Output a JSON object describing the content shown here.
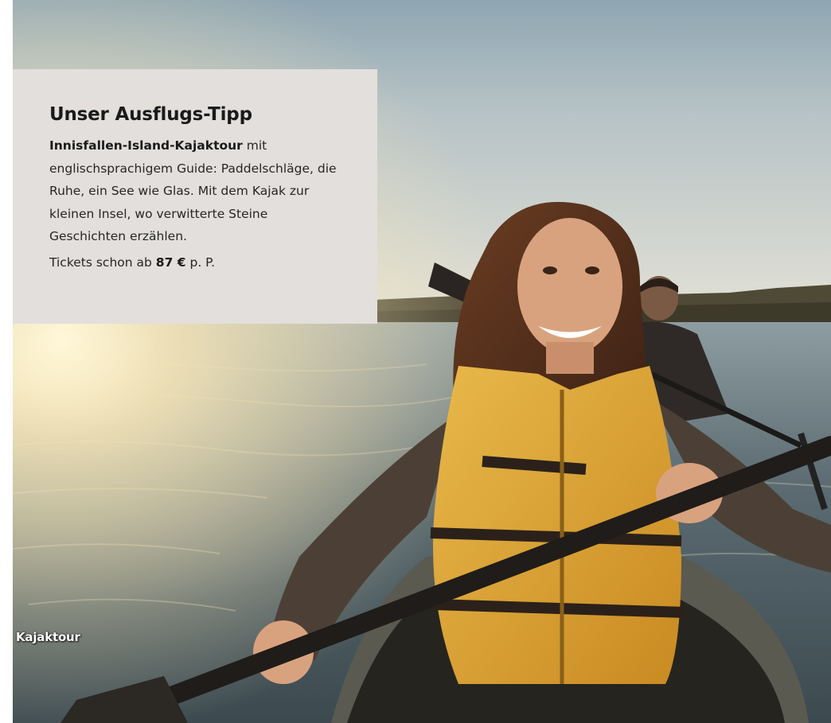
{
  "tip": {
    "title": "Unser Ausflugs-Tipp",
    "tour_name": "Innisfallen-Island-Kajaktour",
    "intro_suffix": " mit englischsprachigem Guide: Paddelschläge, die Ruhe, ein See wie Glas. Mit dem Kajak zur kleinen Insel, wo verwitterte Steine Geschichten erzählen.",
    "price_prefix": "Tickets schon ab ",
    "price": "87 €",
    "price_suffix": " p. P."
  },
  "photo": {
    "caption": "Kajaktour"
  }
}
